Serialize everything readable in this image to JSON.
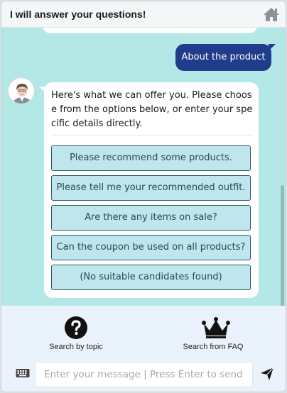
{
  "header": {
    "title": "I will answer your questions!",
    "home_icon": "home-icon"
  },
  "chat": {
    "user_message": "About the product",
    "bot_message": "Here's what we can offer you. Please choose from the options below, or enter your specific details directly.",
    "options": [
      "Please recommend some products.",
      "Please tell me your recommended outfit.",
      "Are there any items on sale?",
      "Can the coupon be used on all products?",
      "(No suitable candidates found)"
    ]
  },
  "footer": {
    "topic_label": "Search by topic",
    "faq_label": "Search from FAQ",
    "input_placeholder": "Enter your message | Press Enter to send"
  },
  "colors": {
    "chat_bg": "#b4e8e6",
    "user_bubble": "#1f3d8a",
    "option_bg": "#bfe6ec",
    "option_border": "#2a5b6b",
    "footer_bg": "#eaf3fb"
  }
}
